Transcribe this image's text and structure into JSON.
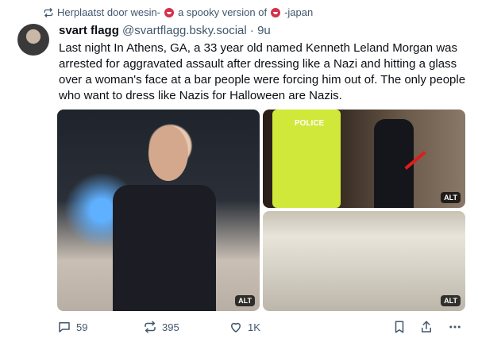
{
  "repost": {
    "label": "Herplaatst door wesin-",
    "suffix": "a spooky version of",
    "tail": "-japan",
    "icon": "repost-icon"
  },
  "post": {
    "author_name": "svart flagg",
    "handle": "@svartflagg.bsky.social",
    "separator": "·",
    "time": "9u",
    "text": "Last night In Athens, GA, a 33 year old named Kenneth Leland Morgan was arrested for aggravated assault after dressing like a Nazi and hitting a glass over a woman's face at a bar people were forcing him out of. The only people who want to dress like Nazis for Halloween are Nazis."
  },
  "media": {
    "images": [
      {
        "alt_badge": "ALT",
        "description": "Person in black uniform costume"
      },
      {
        "alt_badge": "ALT",
        "description": "Police officer escorting man in black uniform",
        "police_label": "POLICE"
      },
      {
        "alt_badge": "ALT",
        "description": "Blurred light image"
      }
    ]
  },
  "actions": {
    "reply_count": "59",
    "repost_count": "395",
    "like_count": "1K"
  },
  "colors": {
    "text": "#0b0f14",
    "muted": "#42576c",
    "emoji_red": "#d6304a"
  }
}
